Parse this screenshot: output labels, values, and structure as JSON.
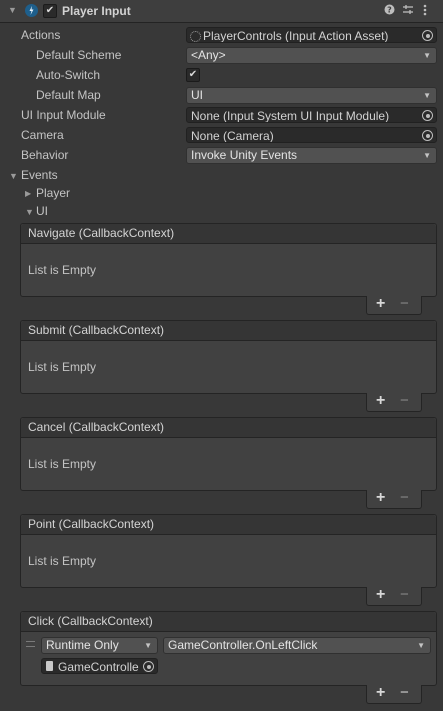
{
  "component": {
    "title": "Player Input",
    "enabled": true
  },
  "properties": {
    "actions": {
      "label": "Actions",
      "value": "PlayerControls (Input Action Asset)"
    },
    "default_scheme": {
      "label": "Default Scheme",
      "value": "<Any>"
    },
    "auto_switch": {
      "label": "Auto-Switch",
      "checked": true
    },
    "default_map": {
      "label": "Default Map",
      "value": "UI"
    },
    "ui_input_module": {
      "label": "UI Input Module",
      "value": "None (Input System UI Input Module)"
    },
    "camera": {
      "label": "Camera",
      "value": "None (Camera)"
    },
    "behavior": {
      "label": "Behavior",
      "value": "Invoke Unity Events"
    }
  },
  "events": {
    "label": "Events",
    "groups": [
      {
        "label": "Player",
        "expanded": false
      },
      {
        "label": "UI",
        "expanded": true
      }
    ],
    "items": [
      {
        "header": "Navigate (CallbackContext)",
        "empty_text": "List is Empty"
      },
      {
        "header": "Submit (CallbackContext)",
        "empty_text": "List is Empty"
      },
      {
        "header": "Cancel (CallbackContext)",
        "empty_text": "List is Empty"
      },
      {
        "header": "Point (CallbackContext)",
        "empty_text": "List is Empty"
      }
    ],
    "click": {
      "header": "Click (CallbackContext)",
      "call_state": "Runtime Only",
      "function": "GameController.OnLeftClick",
      "target": "GameControlle"
    }
  },
  "icons": {
    "help": "help-icon",
    "presets": "presets-icon",
    "menu": "kebab-menu-icon",
    "component": "input-component-icon"
  },
  "colors": {
    "background": "#383838",
    "header": "#3e3e3e",
    "field": "#2a2a2a",
    "dropdown": "#515151",
    "text": "#c4c4c4"
  }
}
